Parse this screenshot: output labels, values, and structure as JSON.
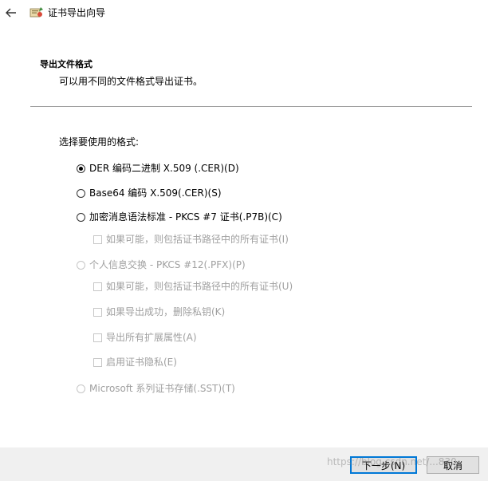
{
  "window": {
    "title": "证书导出向导"
  },
  "header": {
    "section_title": "导出文件格式",
    "section_desc": "可以用不同的文件格式导出证书。"
  },
  "content": {
    "prompt": "选择要使用的格式:",
    "options": [
      {
        "type": "radio",
        "label": "DER 编码二进制 X.509 (.CER)(D)",
        "checked": true,
        "enabled": true
      },
      {
        "type": "radio",
        "label": "Base64 编码 X.509(.CER)(S)",
        "checked": false,
        "enabled": true
      },
      {
        "type": "radio",
        "label": "加密消息语法标准 - PKCS #7 证书(.P7B)(C)",
        "checked": false,
        "enabled": true
      },
      {
        "type": "checkbox",
        "label": "如果可能，则包括证书路径中的所有证书(I)",
        "checked": false,
        "enabled": false
      },
      {
        "type": "radio",
        "label": "个人信息交换 - PKCS #12(.PFX)(P)",
        "checked": false,
        "enabled": false
      },
      {
        "type": "checkbox",
        "label": "如果可能，则包括证书路径中的所有证书(U)",
        "checked": false,
        "enabled": false
      },
      {
        "type": "checkbox",
        "label": "如果导出成功，删除私钥(K)",
        "checked": false,
        "enabled": false
      },
      {
        "type": "checkbox",
        "label": "导出所有扩展属性(A)",
        "checked": false,
        "enabled": false
      },
      {
        "type": "checkbox",
        "label": "启用证书隐私(E)",
        "checked": false,
        "enabled": false
      },
      {
        "type": "radio",
        "label": "Microsoft 系列证书存储(.SST)(T)",
        "checked": false,
        "enabled": false
      }
    ]
  },
  "footer": {
    "next_label": "下一步(N)",
    "cancel_label": "取消"
  },
  "watermark": "https://blog.csdn.net/...830",
  "colors": {
    "accent": "#0078d7",
    "footer_bg": "#f0f0f0",
    "disabled_text": "#a0a0a0"
  }
}
